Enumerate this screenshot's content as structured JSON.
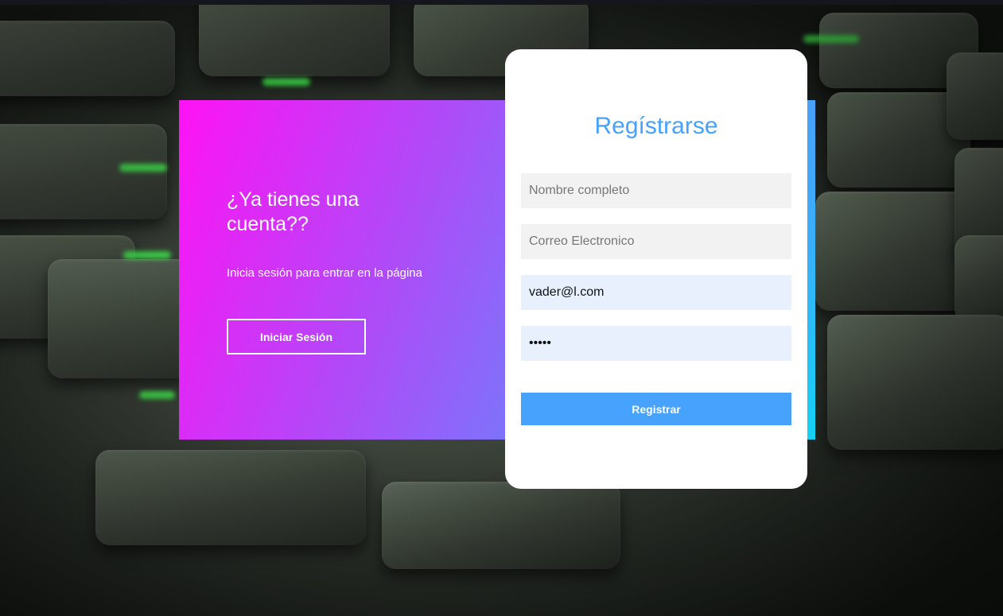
{
  "info": {
    "title": "¿Ya tienes una cuenta??",
    "subtitle": "Inicia sesión para entrar en la página",
    "login_button": "Iniciar Sesión"
  },
  "register": {
    "title": "Regístrarse",
    "full_name": {
      "placeholder": "Nombre completo",
      "value": ""
    },
    "email": {
      "placeholder": "Correo Electronico",
      "value": ""
    },
    "username": {
      "value": "vader@l.com"
    },
    "password": {
      "value": "•••••"
    },
    "submit_button": "Registrar"
  },
  "colors": {
    "accent": "#46a2fd",
    "gradient_start": "#ff12f5",
    "gradient_end": "#11d4f2"
  }
}
